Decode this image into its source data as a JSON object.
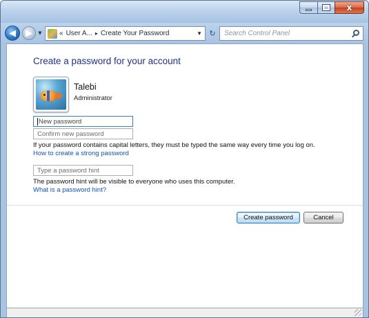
{
  "window": {
    "caption": {
      "minimize": "",
      "maximize": "",
      "close": "x"
    }
  },
  "navbar": {
    "address": {
      "overflow": "«",
      "segments": [
        "User A...",
        "Create Your Password"
      ],
      "separator": "▸"
    },
    "search_placeholder": "Search Control Panel"
  },
  "content": {
    "title": "Create a password for your account",
    "user": {
      "name": "Talebi",
      "role": "Administrator"
    },
    "fields": {
      "new_password": {
        "placeholder": "New password",
        "value": ""
      },
      "confirm_password": {
        "placeholder": "Confirm new password",
        "value": ""
      },
      "password_hint": {
        "placeholder": "Type a password hint",
        "value": ""
      }
    },
    "caps_note": "If your password contains capital letters, they must be typed the same way every time you log on.",
    "strong_password_link": "How to create a strong password",
    "hint_note": "The password hint will be visible to everyone who uses this computer.",
    "hint_link": "What is a password hint?",
    "buttons": {
      "create": "Create password",
      "cancel": "Cancel"
    }
  },
  "colors": {
    "title": "#1e3287",
    "link": "#0b54b8",
    "window_frame": "#a9c4e0"
  }
}
